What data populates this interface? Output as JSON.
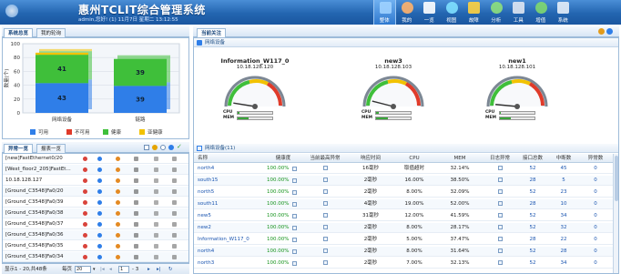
{
  "app": {
    "title": "惠州TCLIT综合管理系统",
    "subtitle": "admin,您好! (1) 11月7日 星期二 13:12:55"
  },
  "nav": [
    {
      "label": "整体",
      "icon": "monitor-icon",
      "active": true
    },
    {
      "label": "我的",
      "icon": "user-icon",
      "active": false
    },
    {
      "label": "一览",
      "icon": "list-icon",
      "active": false
    },
    {
      "label": "视图",
      "icon": "topology-icon",
      "active": false
    },
    {
      "label": "故障",
      "icon": "warning-icon",
      "active": false
    },
    {
      "label": "分析",
      "icon": "pie-icon",
      "active": false
    },
    {
      "label": "工具",
      "icon": "wrench-icon",
      "active": false
    },
    {
      "label": "增值",
      "icon": "plus-icon",
      "active": false
    },
    {
      "label": "系统",
      "icon": "gear-icon",
      "active": false
    }
  ],
  "left_top": {
    "tabs": [
      "系统总览",
      "我的轮询"
    ],
    "active_tab": 0
  },
  "chart_data": {
    "type": "bar",
    "categories": [
      "网络设备",
      "链路"
    ],
    "series": [
      {
        "name": "可用",
        "color": "#2f7ee8",
        "values": [
          43,
          39
        ]
      },
      {
        "name": "不可用",
        "color": "#e03b2a",
        "values": [
          0,
          0
        ]
      },
      {
        "name": "健康",
        "color": "#3fbf3a",
        "values": [
          41,
          39
        ]
      },
      {
        "name": "亚健康",
        "color": "#f2c200",
        "values": [
          3,
          0
        ]
      }
    ],
    "ylabel": "数量(个)",
    "ylim": [
      0,
      100
    ],
    "yticks": [
      0,
      20,
      40,
      60,
      80,
      100
    ],
    "stacked": true,
    "legend_position": "bottom",
    "grid": true
  },
  "left_bottom": {
    "tabs": [
      "异常一览",
      "报表一览"
    ],
    "active_tab": 0,
    "rows": [
      "[new]FastEthernet0/20",
      "[West_floor2_205]FastEt...",
      "10.18.128.127",
      "[Ground_C3548]Fa0/20",
      "[Ground_C3548]Fa0/39",
      "[Ground_C3548]Fa0/38",
      "[Ground_C3548]Fa0/37",
      "[Ground_C3548]Fa0/36",
      "[Ground_C3548]Fa0/35",
      "[Ground_C3548]Fa0/34"
    ],
    "pager": {
      "summary": "显示1 - 20,共48条",
      "per_page_label": "每页",
      "per_page_value": "20",
      "page_value": "1",
      "page_total": "- 3"
    }
  },
  "right": {
    "tabs": [
      "当前关注"
    ],
    "gauges_section": "网络设备",
    "gauges": [
      {
        "name": "Information_W117_0",
        "ip": "10.18.128.120",
        "cpu": 5,
        "mem": 32
      },
      {
        "name": "new3",
        "ip": "10.18.128.103",
        "cpu": 8,
        "mem": 33
      },
      {
        "name": "new1",
        "ip": "10.18.128.101",
        "cpu": 3,
        "mem": 32
      }
    ],
    "cpu_label": "CPU",
    "mem_label": "MEM",
    "table_section": "网络设备(11)",
    "columns": [
      "名称",
      "健康度",
      "当前最高异常",
      "响应时间",
      "CPU",
      "MEM",
      "日志异常",
      "接口总数",
      "中断数",
      "异常数"
    ],
    "rows": [
      {
        "name": "north4",
        "health": "100.00%",
        "resp": "16毫秒",
        "cpu": "取值超时",
        "mem": "32.14%",
        "ports": "52",
        "down": "45",
        "alarm": "0"
      },
      {
        "name": "south15",
        "health": "100.00%",
        "resp": "2毫秒",
        "cpu": "16.00%",
        "mem": "38.50%",
        "ports": "28",
        "down": "5",
        "alarm": "0"
      },
      {
        "name": "north5",
        "health": "100.00%",
        "resp": "2毫秒",
        "cpu": "8.00%",
        "mem": "32.09%",
        "ports": "52",
        "down": "23",
        "alarm": "0"
      },
      {
        "name": "south11",
        "health": "100.00%",
        "resp": "4毫秒",
        "cpu": "19.00%",
        "mem": "52.00%",
        "ports": "28",
        "down": "10",
        "alarm": "0"
      },
      {
        "name": "new5",
        "health": "100.00%",
        "resp": "31毫秒",
        "cpu": "12.00%",
        "mem": "41.59%",
        "ports": "52",
        "down": "34",
        "alarm": "0"
      },
      {
        "name": "new2",
        "health": "100.00%",
        "resp": "2毫秒",
        "cpu": "8.00%",
        "mem": "28.17%",
        "ports": "52",
        "down": "32",
        "alarm": "0"
      },
      {
        "name": "Information_W117_0",
        "health": "100.00%",
        "resp": "2毫秒",
        "cpu": "5.00%",
        "mem": "37.47%",
        "ports": "28",
        "down": "22",
        "alarm": "0"
      },
      {
        "name": "north4",
        "health": "100.00%",
        "resp": "2毫秒",
        "cpu": "8.00%",
        "mem": "31.64%",
        "ports": "52",
        "down": "28",
        "alarm": "0"
      },
      {
        "name": "north3",
        "health": "100.00%",
        "resp": "2毫秒",
        "cpu": "7.00%",
        "mem": "32.13%",
        "ports": "52",
        "down": "34",
        "alarm": "0"
      }
    ]
  }
}
